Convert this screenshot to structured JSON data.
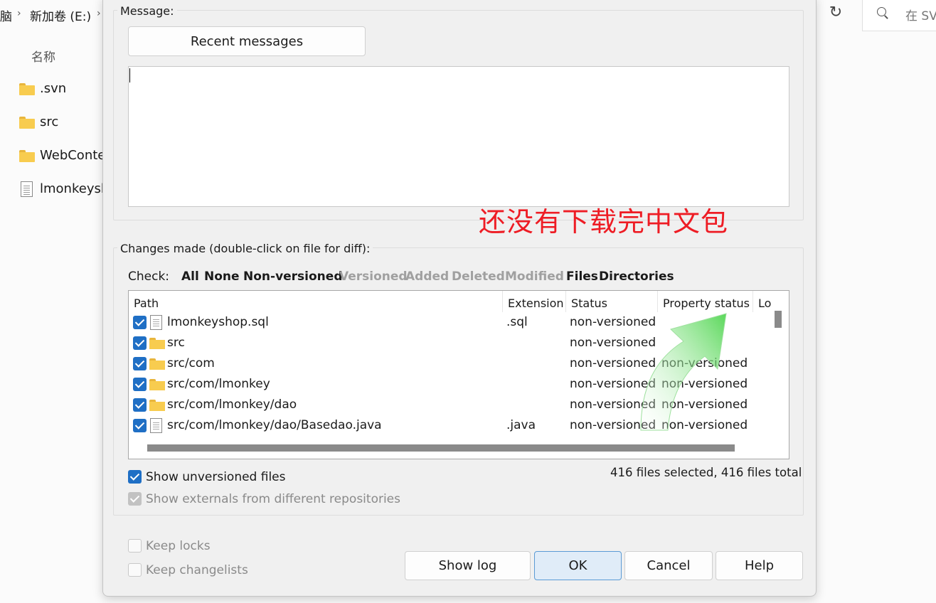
{
  "explorer": {
    "breadcrumb": {
      "part1": "脑",
      "part2": "新加卷 (E:)"
    },
    "search_placeholder": "在 SV",
    "column_name": "名称",
    "files": [
      {
        "name": ".svn",
        "icon": "folder-icon"
      },
      {
        "name": "src",
        "icon": "folder-icon"
      },
      {
        "name": "WebConte",
        "icon": "folder-icon"
      },
      {
        "name": "lmonkeysh",
        "icon": "file-icon"
      }
    ]
  },
  "dialog": {
    "message_group_title": "Message:",
    "recent_messages_label": "Recent messages",
    "message_text": "",
    "annotation_text": "还没有下载完中文包",
    "changes_group_title": "Changes made (double-click on file for diff):",
    "check_label": "Check:",
    "check_filters": [
      {
        "label": "All",
        "enabled": true
      },
      {
        "label": "None",
        "enabled": true
      },
      {
        "label": "Non-versioned",
        "enabled": true
      },
      {
        "label": "Versioned",
        "enabled": false
      },
      {
        "label": "Added",
        "enabled": false
      },
      {
        "label": "Deleted",
        "enabled": false
      },
      {
        "label": "Modified",
        "enabled": false
      },
      {
        "label": "Files",
        "enabled": true
      },
      {
        "label": "Directories",
        "enabled": true
      }
    ],
    "columns": [
      "Path",
      "Extension",
      "Status",
      "Property status",
      "Lo"
    ],
    "rows": [
      {
        "path": "lmonkeyshop.sql",
        "ext": ".sql",
        "status": "non-versioned",
        "prop": "",
        "type": "file",
        "checked": true
      },
      {
        "path": "src",
        "ext": "",
        "status": "non-versioned",
        "prop": "",
        "type": "folder",
        "checked": true
      },
      {
        "path": "src/com",
        "ext": "",
        "status": "non-versioned",
        "prop": "non-versioned",
        "type": "folder",
        "checked": true
      },
      {
        "path": "src/com/lmonkey",
        "ext": "",
        "status": "non-versioned",
        "prop": "non-versioned",
        "type": "folder",
        "checked": true
      },
      {
        "path": "src/com/lmonkey/dao",
        "ext": "",
        "status": "non-versioned",
        "prop": "non-versioned",
        "type": "folder",
        "checked": true
      },
      {
        "path": "src/com/lmonkey/dao/Basedao.java",
        "ext": ".java",
        "status": "non-versioned",
        "prop": "non-versioned",
        "type": "file",
        "checked": true
      }
    ],
    "show_unversioned_label": "Show unversioned files",
    "show_unversioned_checked": true,
    "show_externals_label": "Show externals from different repositories",
    "show_externals_checked": true,
    "selection_summary": "416 files selected, 416 files total",
    "keep_locks_label": "Keep locks",
    "keep_locks_checked": false,
    "keep_changelists_label": "Keep changelists",
    "keep_changelists_checked": false,
    "buttons": {
      "show_log": "Show log",
      "ok": "OK",
      "cancel": "Cancel",
      "help": "Help"
    }
  },
  "colors": {
    "annotation_red": "#ee1c24",
    "checkbox_blue": "#1f6fc5",
    "arrow_green": "#3dd13d"
  }
}
